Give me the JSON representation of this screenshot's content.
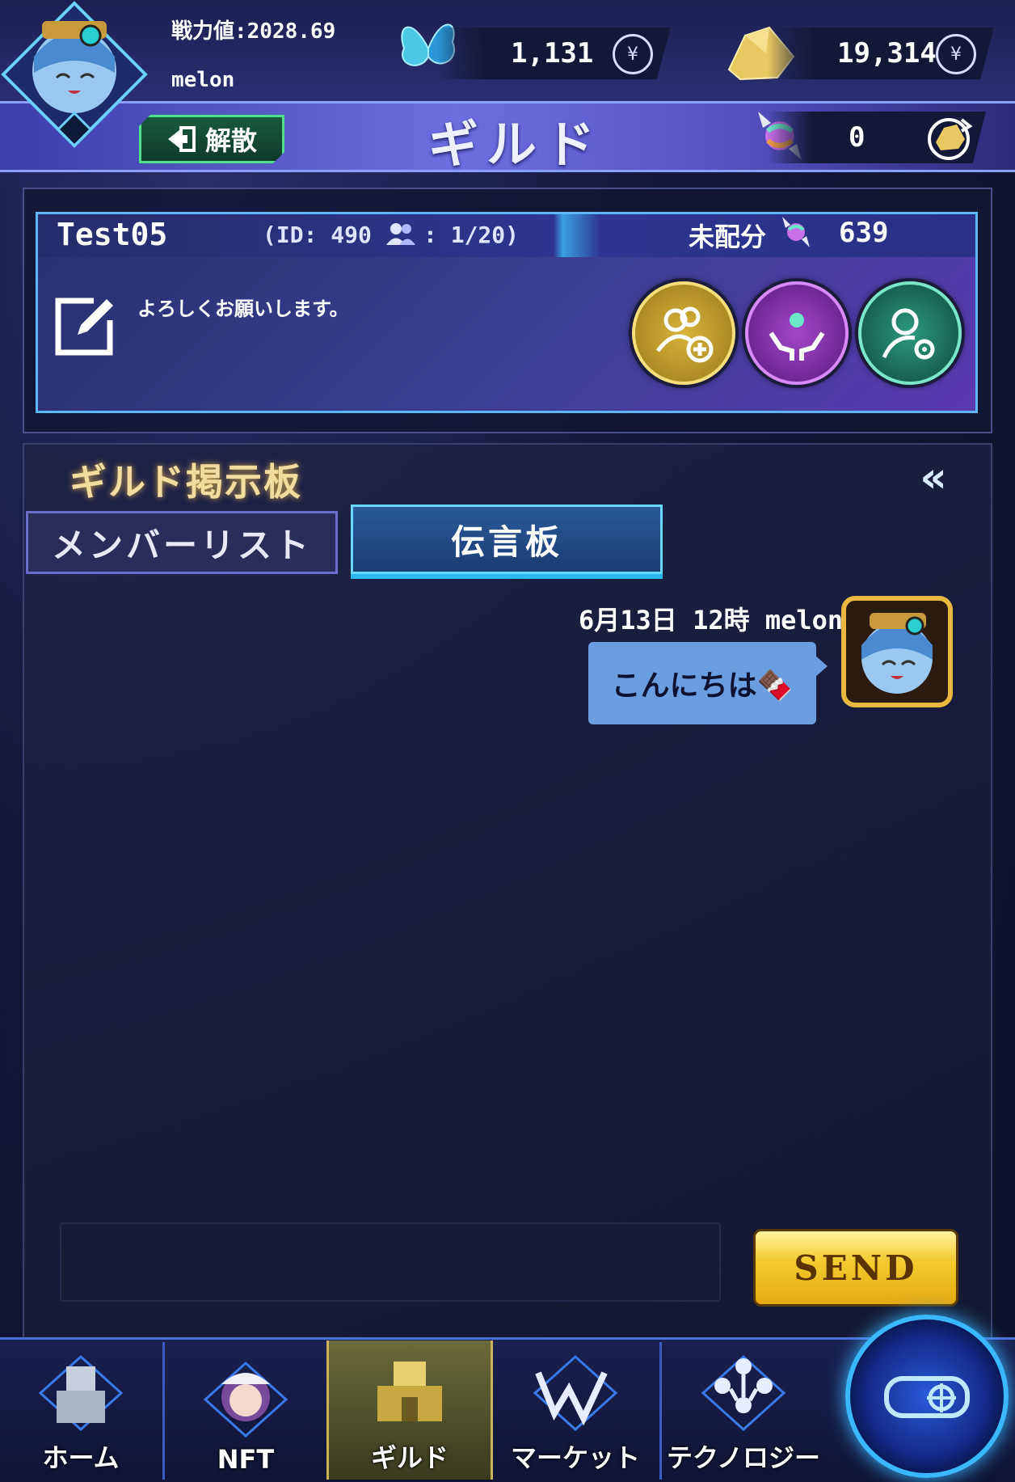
{
  "header": {
    "power_label": "戦力値:2028.69",
    "username": "melon",
    "disband_label": "解散",
    "title": "ギルド"
  },
  "currencies": {
    "butterfly": {
      "value": "1,131",
      "icon": "butterfly-icon"
    },
    "gold": {
      "value": "19,314",
      "icon": "gold-ingot-icon"
    },
    "candy": {
      "value": "0",
      "icon": "candy-icon"
    }
  },
  "guild": {
    "name": "Test05",
    "id_text": "(ID: 490",
    "member_text": ": 1/20)",
    "undistributed_label": "未配分",
    "undistributed_value": "639",
    "message": "よろしくお願いします。"
  },
  "board": {
    "title": "ギルド掲示板",
    "tabs": [
      {
        "label": "メンバーリスト",
        "active": false
      },
      {
        "label": "伝言板",
        "active": true
      }
    ],
    "messages": [
      {
        "meta": "6月13日 12時  melon",
        "text": "こんにちは🍫"
      }
    ],
    "input_placeholder": "",
    "send_label": "SEND"
  },
  "nav": {
    "items": [
      {
        "label": "ホーム"
      },
      {
        "label": "NFT"
      },
      {
        "label": "ギルド"
      },
      {
        "label": "マーケット"
      },
      {
        "label": "テクノロジー"
      }
    ]
  },
  "colors": {
    "accent_blue": "#5fb8ff",
    "gold": "#f2cc30",
    "title_bar": "#6e6ee0",
    "bubble": "#6a9ee0"
  }
}
